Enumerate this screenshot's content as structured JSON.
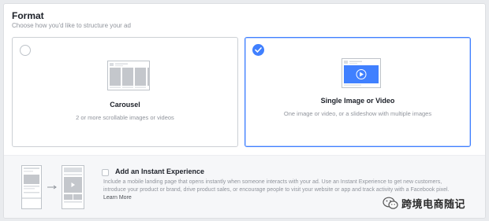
{
  "format": {
    "title": "Format",
    "subtitle": "Choose how you'd like to structure your ad"
  },
  "cards": [
    {
      "label": "Carousel",
      "description": "2 or more scrollable images or videos",
      "selected": false,
      "icon": "carousel-thumbnail-icon"
    },
    {
      "label": "Single Image or Video",
      "description": "One image or video, or a slideshow with multiple images",
      "selected": true,
      "icon": "single-video-thumbnail-icon"
    }
  ],
  "instant_experience": {
    "title": "Add an Instant Experience",
    "description": "Include a mobile landing page that opens instantly when someone interacts with your ad. Use an Instant Experience to get new customers, introduce your product or brand, drive product sales, or encourage people to visit your website or app and track activity with a Facebook pixel.",
    "learn_more": "Learn More",
    "checked": false
  },
  "watermark": {
    "text": "跨境电商随记",
    "icon": "wechat-icon"
  },
  "colors": {
    "accent": "#4080ff",
    "border": "#ccd0d5",
    "muted_text": "#90949c",
    "background": "#e9ebee"
  }
}
